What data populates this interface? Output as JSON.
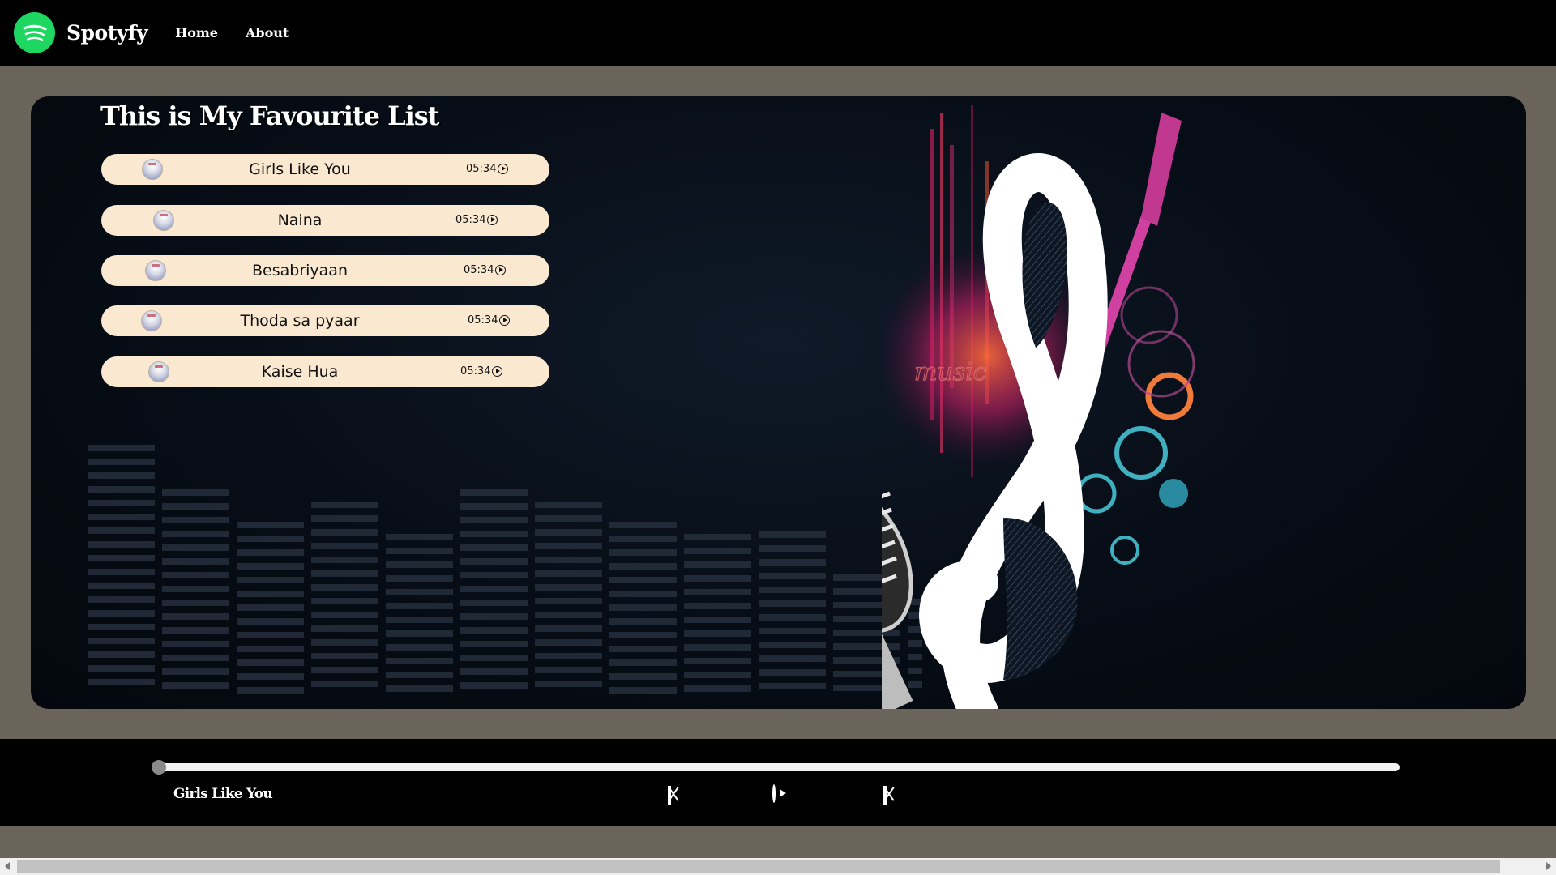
{
  "nav": {
    "brand": "Spotyfy",
    "links": [
      "Home",
      "About"
    ]
  },
  "list": {
    "title": "This is My Favourite List",
    "songs": [
      {
        "name": "Girls Like You",
        "duration": "05:34"
      },
      {
        "name": "Naina",
        "duration": "05:34"
      },
      {
        "name": "Besabriyaan",
        "duration": "05:34"
      },
      {
        "name": "Thoda sa pyaar",
        "duration": "05:34"
      },
      {
        "name": "Kaise Hua",
        "duration": "05:34"
      }
    ]
  },
  "player": {
    "now_playing": "Girls Like You",
    "progress": 0,
    "controls": [
      "previous-icon",
      "play-icon",
      "next-icon"
    ]
  },
  "colors": {
    "accent": "#1ed760",
    "song_pill": "#fbe8d0",
    "page_bg": "#6b645b",
    "bar_bg": "#000000"
  }
}
